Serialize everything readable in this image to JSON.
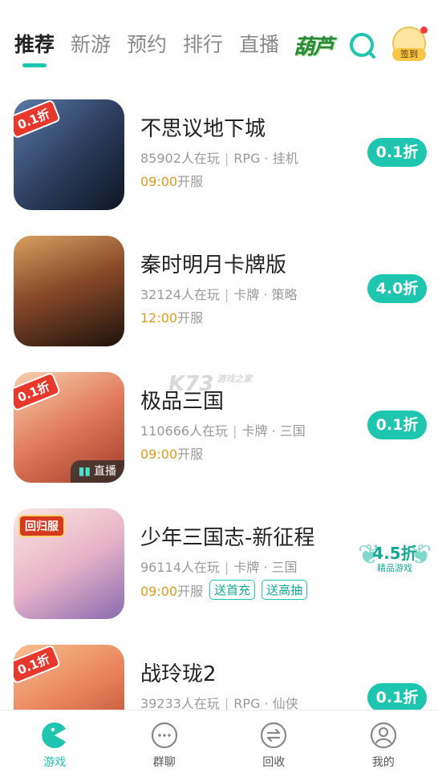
{
  "tabs": [
    "推荐",
    "新游",
    "预约",
    "排行",
    "直播"
  ],
  "logo_text": "葫芦",
  "checkin_label": "签到",
  "games": [
    {
      "title": "不思议地下城",
      "players": "85902人在玩",
      "tags": "RPG · 挂机",
      "time": "09:00",
      "open_text": "开服",
      "discount": "0.1折",
      "ribbon": "0.1折",
      "gifts": [],
      "live": "",
      "colors": [
        "#3a5a8a",
        "#1a2a3a"
      ]
    },
    {
      "title": "秦时明月卡牌版",
      "players": "32124人在玩",
      "tags": "卡牌 · 策略",
      "time": "12:00",
      "open_text": "开服",
      "discount": "4.0折",
      "ribbon": "",
      "gifts": [],
      "live": "",
      "colors": [
        "#b56a3a",
        "#2a1a12"
      ]
    },
    {
      "title": "极品三国",
      "players": "110666人在玩",
      "tags": "卡牌 · 三国",
      "time": "09:00",
      "open_text": "开服",
      "discount": "0.1折",
      "ribbon": "0.1折",
      "gifts": [],
      "live": "直播",
      "colors": [
        "#f0b08a",
        "#c84a3a"
      ]
    },
    {
      "title": "少年三国志-新征程",
      "players": "96114人在玩",
      "tags": "卡牌 · 三国",
      "time": "09:00",
      "open_text": "开服",
      "discount": "",
      "premium_value": "4.5折",
      "premium_label": "精品游戏",
      "ribbon": "",
      "huigui": "回归服",
      "gifts": [
        "送首充",
        "送高抽"
      ],
      "live": "",
      "colors": [
        "#f5d0c8",
        "#a88ac8"
      ]
    },
    {
      "title": "战玲珑2",
      "players": "39233人在玩",
      "tags": "RPG · 仙侠",
      "time": "",
      "open_text": "",
      "discount": "0.1折",
      "ribbon": "0.1折",
      "gifts": [],
      "live": "",
      "colors": [
        "#f4a070",
        "#d04a30"
      ]
    }
  ],
  "watermark": "K73",
  "watermark_sub": "游戏之家",
  "nav": [
    {
      "label": "游戏",
      "icon": "pacman-icon",
      "active": true
    },
    {
      "label": "群聊",
      "icon": "chat-icon",
      "active": false
    },
    {
      "label": "回收",
      "icon": "recycle-icon",
      "active": false
    },
    {
      "label": "我的",
      "icon": "profile-icon",
      "active": false
    }
  ],
  "colors": {
    "accent": "#1ec6b0",
    "time": "#e09a1e",
    "ribbon": "#e8382c"
  }
}
